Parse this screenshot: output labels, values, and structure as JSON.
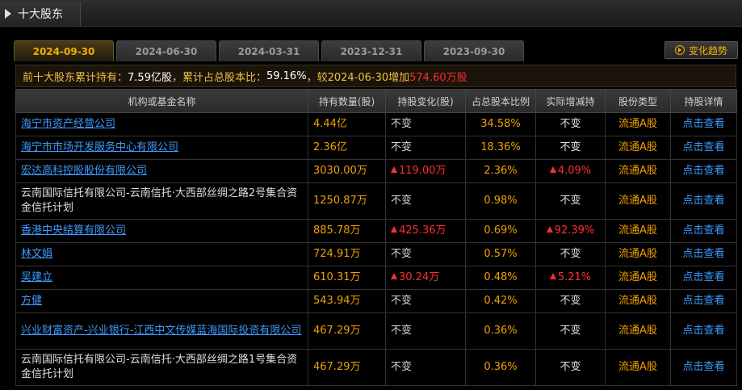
{
  "window": {
    "title": "十大股东"
  },
  "tabs": [
    {
      "label": "2024-09-30",
      "active": true
    },
    {
      "label": "2024-06-30",
      "active": false
    },
    {
      "label": "2024-03-31",
      "active": false
    },
    {
      "label": "2023-12-31",
      "active": false
    },
    {
      "label": "2023-09-30",
      "active": false
    }
  ],
  "trend_button": {
    "label": "变化趋势",
    "icon": "play-circle-icon"
  },
  "summary": {
    "prefix": "前十大股东累计持有：",
    "total": "7.59亿股",
    "mid": "，累计占总股本比：",
    "ratio": "59.16%",
    "comp": "，较2024-06-30增加",
    "increase": "574.60万股"
  },
  "table": {
    "headers": [
      "机构或基金名称",
      "持有数量(股)",
      "持股变化(股)",
      "占总股本比例",
      "实际增减持",
      "股份类型",
      "持股详情"
    ],
    "rows": [
      {
        "name": "海宁市资产经营公司",
        "link": true,
        "qty": "4.44亿",
        "change": "不变",
        "change_up": false,
        "ratio": "34.58%",
        "actual": "不变",
        "actual_up": false,
        "type": "流通A股",
        "detail": "点击查看"
      },
      {
        "name": "海宁市市场开发服务中心有限公司",
        "link": true,
        "qty": "2.36亿",
        "change": "不变",
        "change_up": false,
        "ratio": "18.36%",
        "actual": "不变",
        "actual_up": false,
        "type": "流通A股",
        "detail": "点击查看"
      },
      {
        "name": "宏达高科控股股份有限公司",
        "link": true,
        "qty": "3030.00万",
        "change": "119.00万",
        "change_up": true,
        "ratio": "2.36%",
        "actual": "4.09%",
        "actual_up": true,
        "type": "流通A股",
        "detail": "点击查看"
      },
      {
        "name": "云南国际信托有限公司-云南信托·大西部丝绸之路2号集合资金信托计划",
        "link": false,
        "qty": "1250.87万",
        "change": "不变",
        "change_up": false,
        "ratio": "0.98%",
        "actual": "不变",
        "actual_up": false,
        "type": "流通A股",
        "detail": "点击查看"
      },
      {
        "name": "香港中央结算有限公司",
        "link": true,
        "qty": "885.78万",
        "change": "425.36万",
        "change_up": true,
        "ratio": "0.69%",
        "actual": "92.39%",
        "actual_up": true,
        "type": "流通A股",
        "detail": "点击查看"
      },
      {
        "name": "林文娟",
        "link": true,
        "qty": "724.91万",
        "change": "不变",
        "change_up": false,
        "ratio": "0.57%",
        "actual": "不变",
        "actual_up": false,
        "type": "流通A股",
        "detail": "点击查看"
      },
      {
        "name": "吴建立",
        "link": true,
        "qty": "610.31万",
        "change": "30.24万",
        "change_up": true,
        "ratio": "0.48%",
        "actual": "5.21%",
        "actual_up": true,
        "type": "流通A股",
        "detail": "点击查看"
      },
      {
        "name": "方健",
        "link": true,
        "qty": "543.94万",
        "change": "不变",
        "change_up": false,
        "ratio": "0.42%",
        "actual": "不变",
        "actual_up": false,
        "type": "流通A股",
        "detail": "点击查看"
      },
      {
        "name": "兴业财富资产-兴业银行-江西中文传媒蓝海国际投资有限公司",
        "link": true,
        "qty": "467.29万",
        "change": "不变",
        "change_up": false,
        "ratio": "0.36%",
        "actual": "不变",
        "actual_up": false,
        "type": "流通A股",
        "detail": "点击查看"
      },
      {
        "name": "云南国际信托有限公司-云南信托·大西部丝绸之路1号集合资金信托计划",
        "link": false,
        "qty": "467.29万",
        "change": "不变",
        "change_up": false,
        "ratio": "0.36%",
        "actual": "不变",
        "actual_up": false,
        "type": "流通A股",
        "detail": "点击查看"
      }
    ]
  }
}
